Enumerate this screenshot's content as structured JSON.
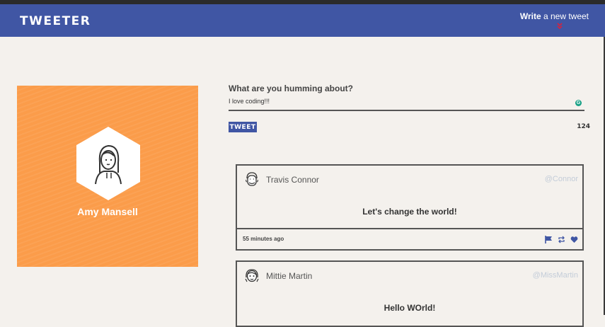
{
  "header": {
    "brand": "TWEETER",
    "compose_bold": "Write",
    "compose_rest": " a new tweet"
  },
  "profile": {
    "name": "Amy Mansell",
    "bg_color": "#fb9c4a"
  },
  "composer": {
    "prompt": "What are you humming about?",
    "value": "I love coding!!!",
    "button_label": "TWEET",
    "char_count": "124"
  },
  "tweets": [
    {
      "name": "Travis Connor",
      "handle": "@Connor",
      "content": "Let's change the world!",
      "time": "55 minutes ago"
    },
    {
      "name": "Mittie Martin",
      "handle": "@MissMartin",
      "content": "Hello WOrld!",
      "time": ""
    }
  ],
  "colors": {
    "brand_blue": "#4056a4",
    "accent_red": "#d8223b",
    "handle_gray": "#c3ccd8"
  },
  "icons": [
    "grammar-icon",
    "flag-icon",
    "retweet-icon",
    "heart-icon",
    "chevron-down-icon"
  ]
}
